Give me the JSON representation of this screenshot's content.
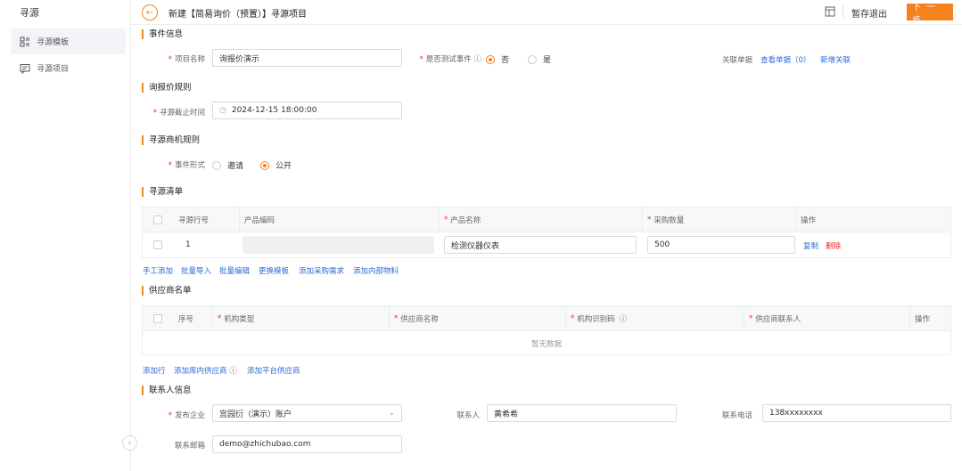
{
  "sidebar": {
    "title": "寻源",
    "items": [
      {
        "label": "寻源模板",
        "active": true
      },
      {
        "label": "寻源项目",
        "active": false
      }
    ]
  },
  "header": {
    "title": "新建【简易询价（预置）】寻源项目",
    "save_label": "暂存退出",
    "next_label": "下一步"
  },
  "event_info": {
    "section_title": "事件信息",
    "project_name_label": "项目名称",
    "project_name_value": "询报价演示",
    "test_event_label": "是否测试事件",
    "test_event_options": [
      "否",
      "是"
    ],
    "test_event_selected": "否",
    "related_doc_label": "关联单据",
    "view_doc_link": "查看单据（0）",
    "add_relation_link": "新增关联"
  },
  "quote_rules": {
    "section_title": "询报价规则",
    "deadline_label": "寻源截止时间",
    "deadline_value": "2024-12-15 18:00:00"
  },
  "supplier_rules": {
    "section_title": "寻源商机规则",
    "form_label": "事件形式",
    "options": [
      "邀请",
      "公开"
    ],
    "selected": "公开"
  },
  "sourcing_list": {
    "section_title": "寻源清单",
    "columns": [
      "寻源行号",
      "产品编码",
      "产品名称",
      "采购数量",
      "操作"
    ],
    "rows": [
      {
        "line_no": "1",
        "product_code": "",
        "product_name": "检测仪器仪表",
        "quantity": "500",
        "copy": "复制",
        "delete": "删除"
      }
    ],
    "actions": [
      "手工添加",
      "批量导入",
      "批量编辑",
      "更换模板",
      "添加采购需求",
      "添加内部物料"
    ]
  },
  "supplier_list": {
    "section_title": "供应商名单",
    "columns": [
      "序号",
      "机构类型",
      "供应商名称",
      "机构识别码",
      "供应商联系人",
      "操作"
    ],
    "empty_text": "暂无数据",
    "actions": [
      "添加行",
      "添加库内供应商",
      "添加平台供应商"
    ]
  },
  "contact_info": {
    "section_title": "联系人信息",
    "company_label": "发布企业",
    "company_value": "宫园衍（演示）账户",
    "contact_label": "联系人",
    "contact_value": "黄希希",
    "phone_label": "联系电话",
    "phone_value": "138xxxxxxxx",
    "email_label": "联系邮箱",
    "email_value": "demo@zhichubao.com"
  }
}
